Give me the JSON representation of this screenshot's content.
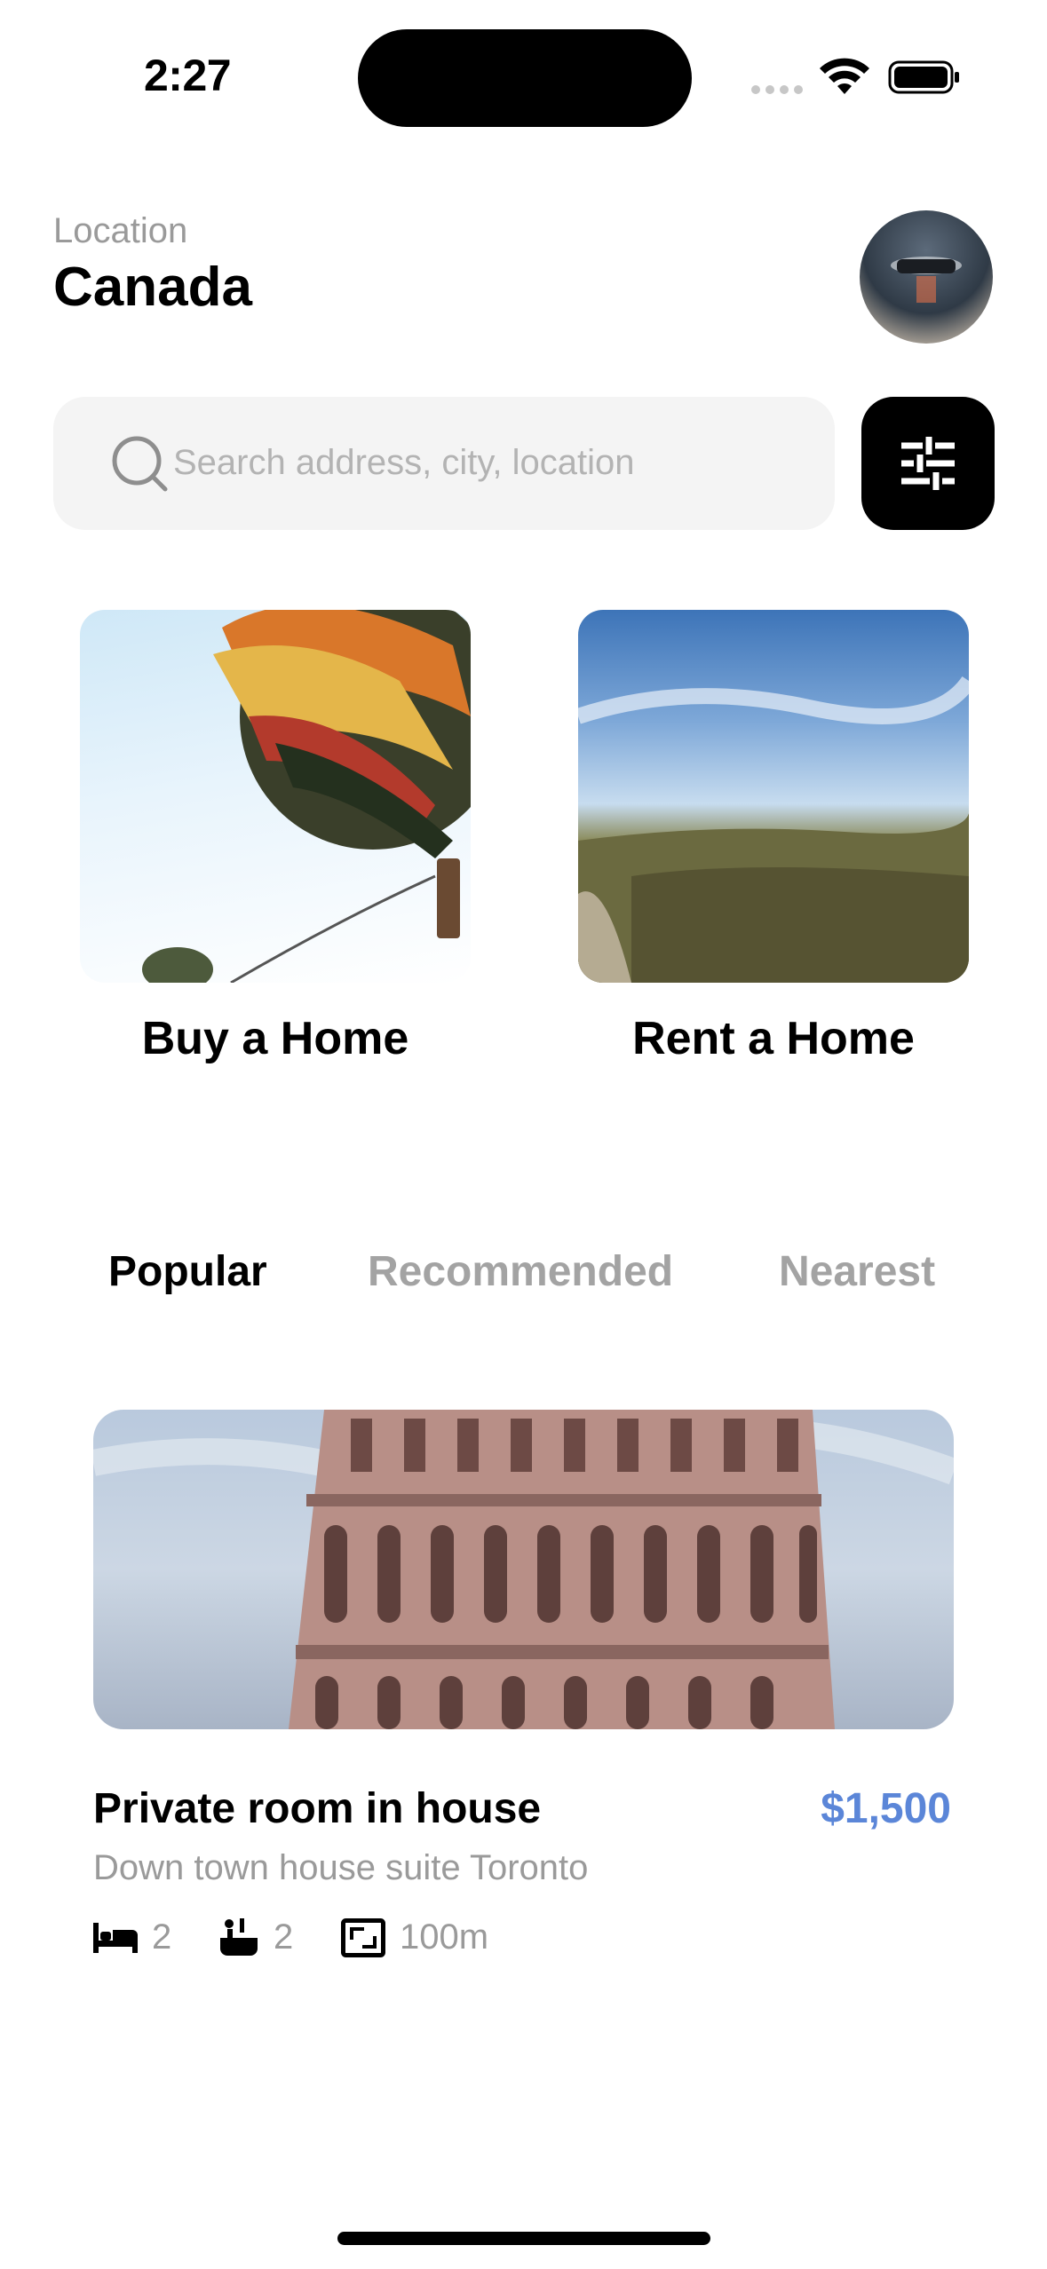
{
  "status_bar": {
    "time": "2:27"
  },
  "header": {
    "location_label": "Location",
    "location_value": "Canada"
  },
  "search": {
    "placeholder": "Search address, city, location"
  },
  "categories": [
    {
      "label": "Buy a Home"
    },
    {
      "label": "Rent a Home"
    }
  ],
  "tabs": [
    {
      "label": "Popular",
      "active": true
    },
    {
      "label": "Recommended",
      "active": false
    },
    {
      "label": "Nearest",
      "active": false
    }
  ],
  "listing": {
    "title": "Private room in house",
    "price": "$1,500",
    "subtitle": "Down town house suite Toronto",
    "beds": "2",
    "baths": "2",
    "area": "100m"
  },
  "colors": {
    "price": "#5b86d8",
    "inactive_tab": "#a3a3a3",
    "search_bg": "#f4f4f4"
  }
}
